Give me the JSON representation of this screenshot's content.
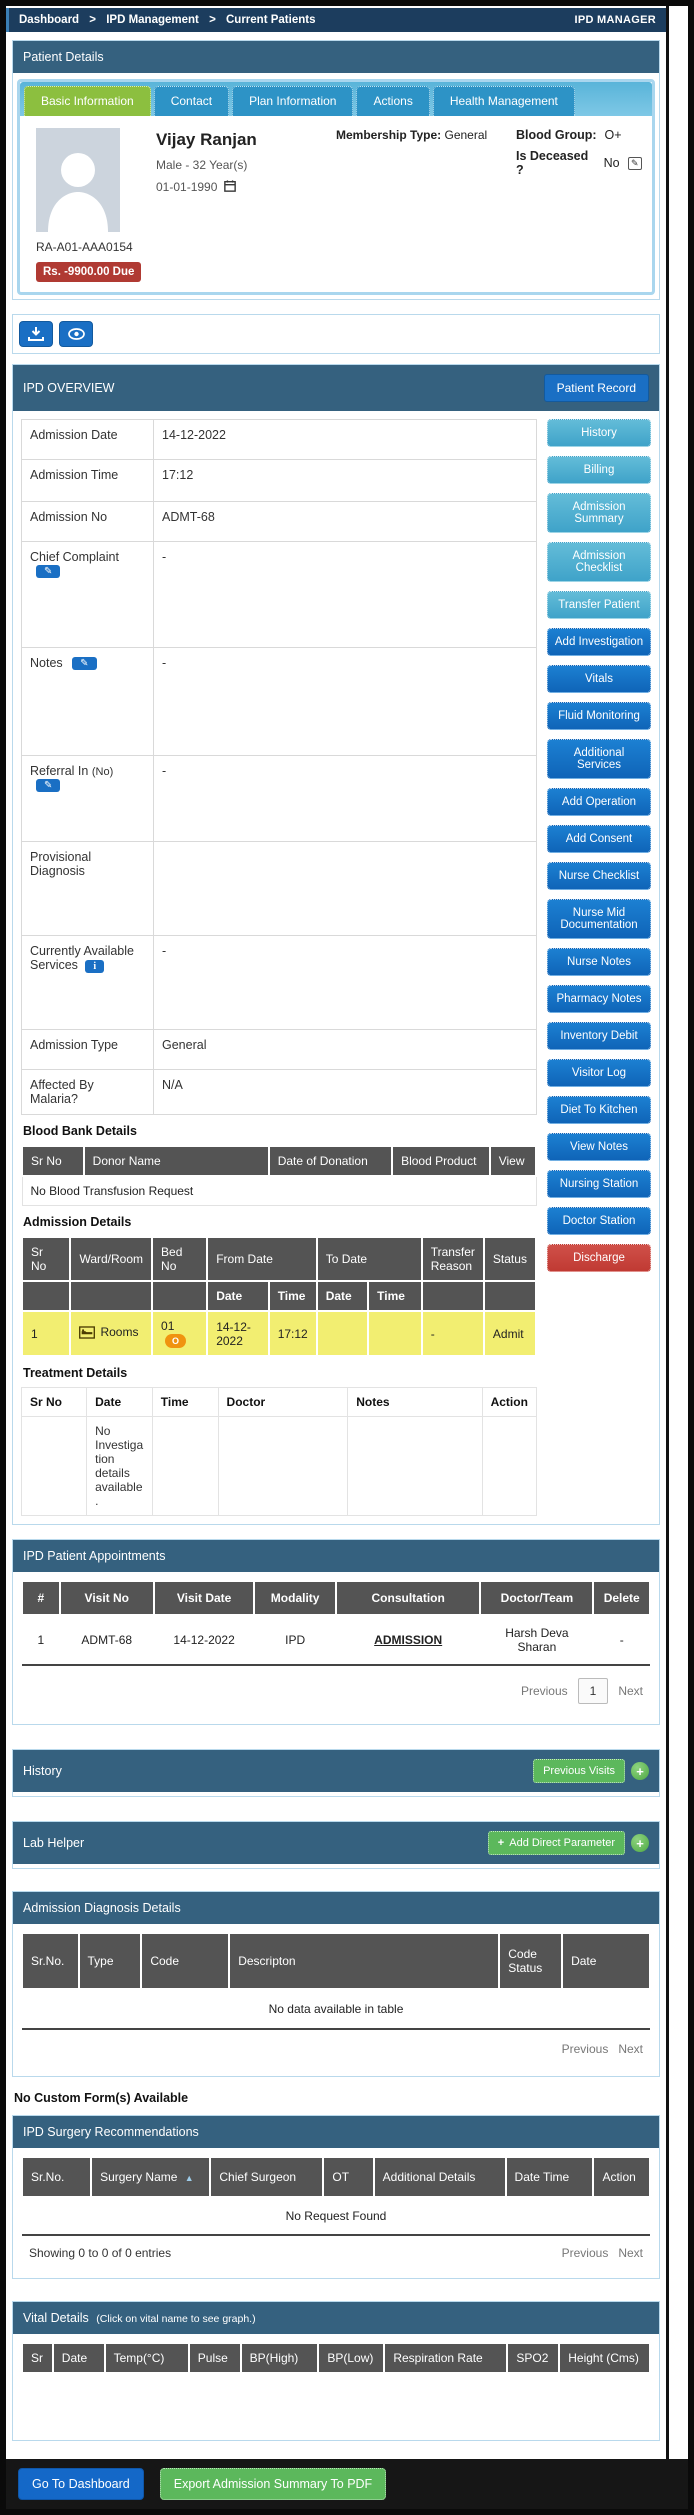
{
  "topbar": {
    "breadcrumb": [
      "Dashboard",
      "IPD Management",
      "Current Patients"
    ],
    "separator": ">",
    "right_label": "IPD MANAGER"
  },
  "icons": {
    "download-icon": "svg-download-tray",
    "eye-icon": "svg-eye",
    "calendar-icon": "svg-calendar",
    "bed-icon": "svg-bed",
    "edit-icon": "✎",
    "info-icon": "i",
    "plus-icon": "+",
    "sort-asc-icon": "▲"
  },
  "colors": {
    "topbar_navy": "#1c3d5e",
    "panel_header_blue": "#35617f",
    "tab_blue": "#2d93c6",
    "tab_active_green": "#8cbf3f",
    "primary_button_blue": "#1472c8",
    "info_button_blue": "#4faecc",
    "danger_red": "#c9443e",
    "success_green": "#5cb85c",
    "highlight_yellow": "#f2ee71",
    "table_header_gray": "#545454",
    "due_badge_red": "#b03a33",
    "footer_dark": "#161616"
  },
  "patient_details": {
    "header": "Patient Details",
    "tabs": [
      {
        "label": "Basic Information"
      },
      {
        "label": "Contact"
      },
      {
        "label": "Plan Information"
      },
      {
        "label": "Actions"
      },
      {
        "label": "Health Management"
      }
    ],
    "patient": {
      "name": "Vijay Ranjan",
      "gender_age": "Male  -  32 Year(s)",
      "dob": "01-01-1990",
      "membership_label": "Membership Type:",
      "membership_value": "General",
      "blood_group_label": "Blood Group:",
      "blood_group_value": "O+",
      "deceased_label": "Is Deceased ?",
      "deceased_value": "No",
      "patient_id": "RA-A01-AAA0154",
      "due_badge": "Rs. -9900.00 Due"
    }
  },
  "ipd_overview": {
    "header": "IPD OVERVIEW",
    "patient_record_button": "Patient Record",
    "fields": [
      {
        "label": "Admission Date",
        "value": "14-12-2022"
      },
      {
        "label": "Admission Time",
        "value": "17:12"
      },
      {
        "label": "Admission No",
        "value": "ADMT-68"
      },
      {
        "label": "Chief Complaint",
        "value": "-"
      },
      {
        "label": "Notes",
        "value": "-"
      },
      {
        "label": "Referral In",
        "suffix": "(No)",
        "value": "-"
      },
      {
        "label": "Provisional Diagnosis",
        "value": ""
      },
      {
        "label": "Currently Available Services",
        "value": "-"
      },
      {
        "label": "Admission Type",
        "value": "General"
      },
      {
        "label": "Affected By Malaria?",
        "value": "N/A"
      }
    ],
    "side_buttons": [
      {
        "label": "History"
      },
      {
        "label": "Billing"
      },
      {
        "label": "Admission Summary"
      },
      {
        "label": "Admission Checklist"
      },
      {
        "label": "Transfer Patient"
      },
      {
        "label": "Add Investigation"
      },
      {
        "label": "Vitals"
      },
      {
        "label": "Fluid Monitoring"
      },
      {
        "label": "Additional Services"
      },
      {
        "label": "Add Operation"
      },
      {
        "label": "Add Consent"
      },
      {
        "label": "Nurse Checklist"
      },
      {
        "label": "Nurse Mid Documentation"
      },
      {
        "label": "Nurse Notes"
      },
      {
        "label": "Pharmacy Notes"
      },
      {
        "label": "Inventory Debit"
      },
      {
        "label": "Visitor Log"
      },
      {
        "label": "Diet To Kitchen"
      },
      {
        "label": "View Notes"
      },
      {
        "label": "Nursing Station"
      },
      {
        "label": "Doctor Station"
      },
      {
        "label": "Discharge"
      }
    ],
    "blood_bank": {
      "title": "Blood Bank Details",
      "headers": [
        "Sr No",
        "Donor Name",
        "Date of Donation",
        "Blood Product",
        "View"
      ],
      "empty_text": "No Blood Transfusion Request"
    },
    "admission_details": {
      "title": "Admission Details",
      "headers_row1": [
        "Sr No",
        "Ward/Room",
        "Bed No",
        "From Date",
        "To Date",
        "Transfer Reason",
        "Status"
      ],
      "headers_row2": [
        "Date",
        "Time",
        "Date",
        "Time"
      ],
      "row": {
        "sr": "1",
        "ward": "Rooms",
        "bed": "01",
        "bed_badge": "O",
        "from_date": "14-12-2022",
        "from_time": "17:12",
        "to_date": "",
        "to_time": "",
        "transfer_reason": "-",
        "status": "Admit"
      }
    },
    "treatment_details": {
      "title": "Treatment Details",
      "headers": [
        "Sr No",
        "Date",
        "Time",
        "Doctor",
        "Notes",
        "Action"
      ],
      "empty_text": "No Investigation details available."
    }
  },
  "appointments": {
    "header": "IPD Patient Appointments",
    "headers": [
      "#",
      "Visit No",
      "Visit Date",
      "Modality",
      "Consultation",
      "Doctor/Team",
      "Delete"
    ],
    "row": {
      "num": "1",
      "visit_no": "ADMT-68",
      "visit_date": "14-12-2022",
      "modality": "IPD",
      "consultation": "ADMISSION",
      "doctor_team": "Harsh Deva Sharan",
      "delete": "-"
    },
    "pagination": {
      "previous": "Previous",
      "page": "1",
      "next": "Next"
    }
  },
  "history": {
    "header": "History",
    "button": "Previous Visits"
  },
  "lab_helper": {
    "header": "Lab Helper",
    "button": "Add Direct Parameter"
  },
  "diagnosis": {
    "header": "Admission Diagnosis Details",
    "headers": [
      "Sr.No.",
      "Type",
      "Code",
      "Descripton",
      "Code Status",
      "Date"
    ],
    "empty_text": "No data available in table",
    "pagination": {
      "previous": "Previous",
      "next": "Next"
    }
  },
  "custom_forms_text": "No Custom Form(s) Available",
  "surgery": {
    "header": "IPD Surgery Recommendations",
    "headers": [
      "Sr.No.",
      "Surgery Name",
      "Chief Surgeon",
      "OT",
      "Additional Details",
      "Date Time",
      "Action"
    ],
    "empty_text": "No Request Found",
    "showing_text": "Showing 0 to 0 of 0 entries",
    "pagination": {
      "previous": "Previous",
      "next": "Next"
    }
  },
  "vitals": {
    "header": "Vital Details",
    "header_note": "(Click on vital name to see graph.)",
    "headers": [
      "Sr",
      "Date",
      "Temp(°C)",
      "Pulse",
      "BP(High)",
      "BP(Low)",
      "Respiration Rate",
      "SPO2",
      "Height (Cms)"
    ]
  },
  "footer": {
    "dashboard_button": "Go To Dashboard",
    "export_button": "Export Admission Summary To PDF"
  }
}
